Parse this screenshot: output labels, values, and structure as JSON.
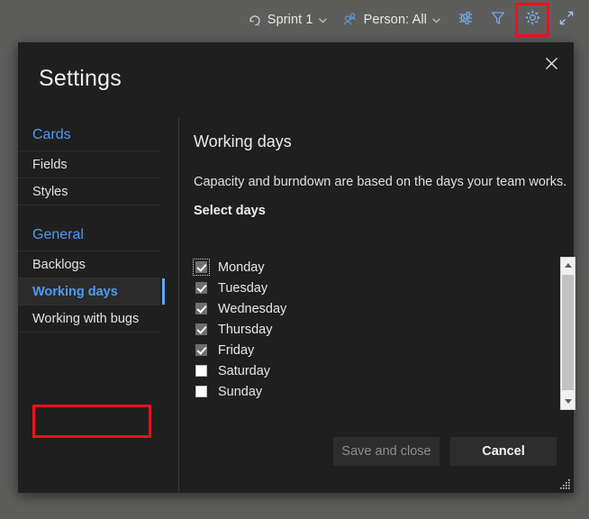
{
  "toolbar": {
    "sprint": {
      "icon": "sprint-icon",
      "label": "Sprint 1",
      "chevron": "chevron-down-icon"
    },
    "person": {
      "icon": "people-icon",
      "label": "Person: All",
      "chevron": "chevron-down-icon"
    },
    "view_options_icon": "sliders-icon",
    "filter_icon": "funnel-icon",
    "settings_icon": "gear-icon",
    "fullscreen_icon": "expand-arrows-icon"
  },
  "dialog": {
    "title": "Settings",
    "close_icon": "close-icon",
    "nav": [
      {
        "type": "group",
        "label": "Cards"
      },
      {
        "type": "item",
        "label": "Fields",
        "selected": false
      },
      {
        "type": "item",
        "label": "Styles",
        "selected": false
      },
      {
        "type": "group",
        "label": "General"
      },
      {
        "type": "item",
        "label": "Backlogs",
        "selected": false
      },
      {
        "type": "item",
        "label": "Working days",
        "selected": true
      },
      {
        "type": "item",
        "label": "Working with bugs",
        "selected": false
      }
    ],
    "content": {
      "heading": "Working days",
      "description": "Capacity and burndown are based on the days your team works.",
      "subheading": "Select days",
      "days": [
        {
          "label": "Monday",
          "checked": true,
          "focused": true
        },
        {
          "label": "Tuesday",
          "checked": true,
          "focused": false
        },
        {
          "label": "Wednesday",
          "checked": true,
          "focused": false
        },
        {
          "label": "Thursday",
          "checked": true,
          "focused": false
        },
        {
          "label": "Friday",
          "checked": true,
          "focused": false
        },
        {
          "label": "Saturday",
          "checked": false,
          "focused": false
        },
        {
          "label": "Sunday",
          "checked": false,
          "focused": false
        }
      ]
    },
    "footer": {
      "save_label": "Save and close",
      "save_disabled": true,
      "cancel_label": "Cancel"
    }
  },
  "colors": {
    "accent_blue": "#4e9bf0",
    "annotation_red": "#fb0d1b",
    "dialog_bg": "#1f1f1f",
    "page_bg": "#5d5d5c"
  }
}
